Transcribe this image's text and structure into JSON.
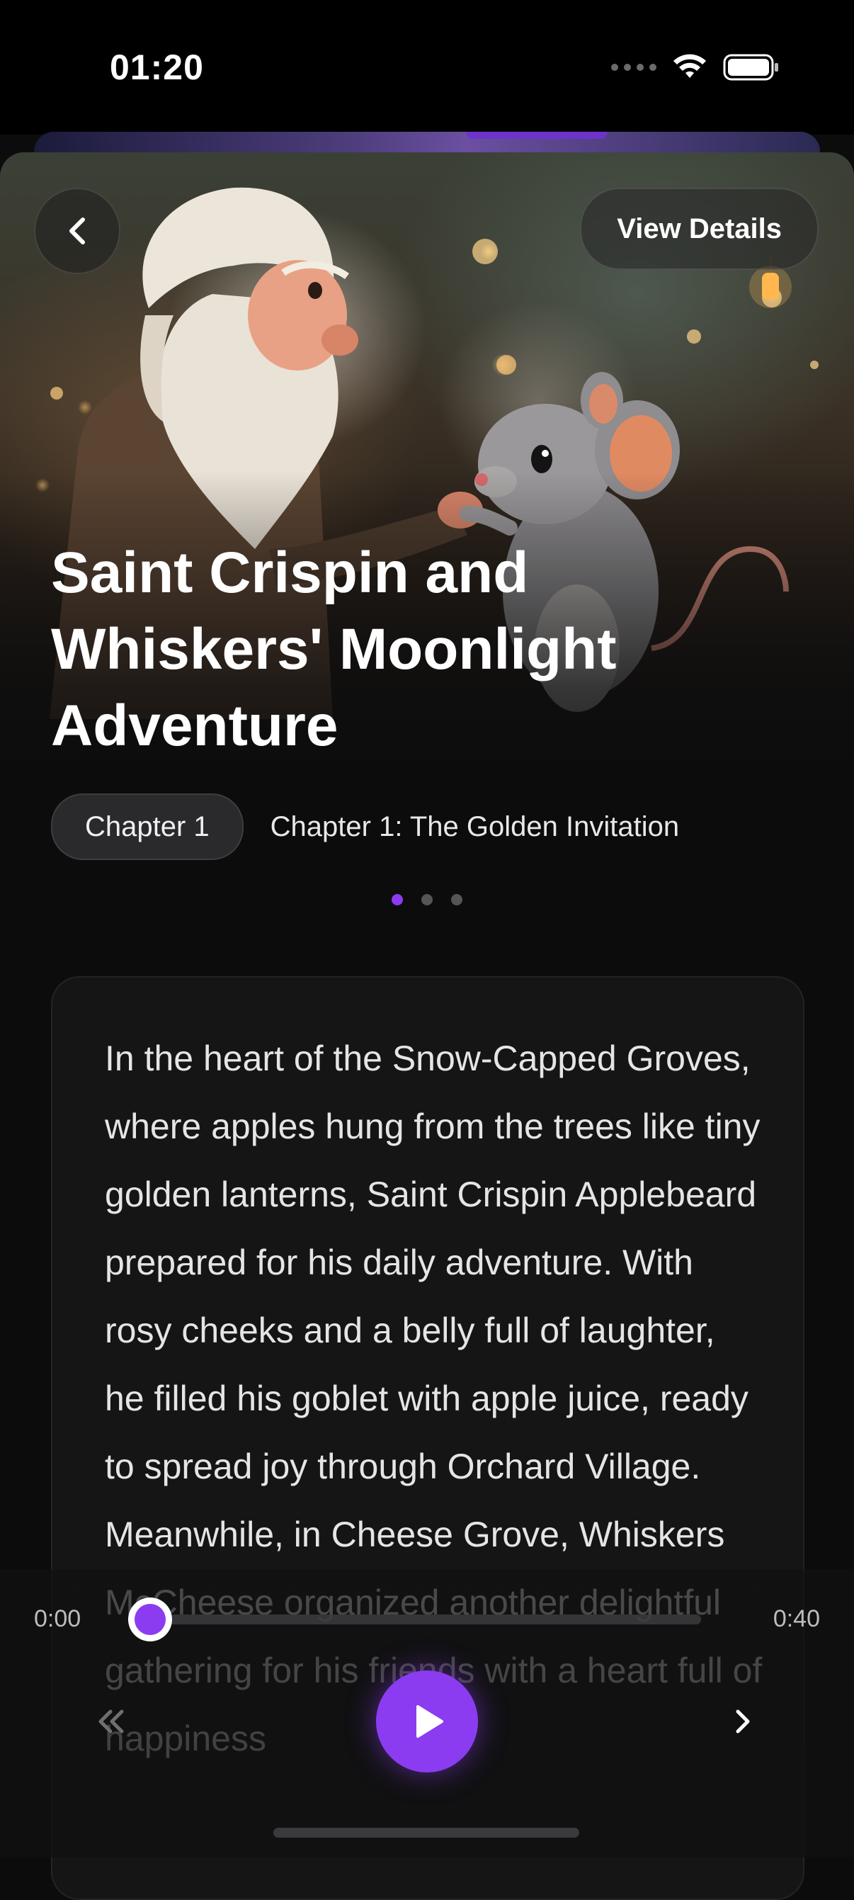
{
  "status_bar": {
    "time": "01:20"
  },
  "header": {
    "view_details_label": "View Details"
  },
  "story": {
    "title": "Saint Crispin and Whiskers' Moonlight Adventure",
    "chapter_badge": "Chapter 1",
    "chapter_title": "Chapter 1: The Golden Invitation",
    "pager": {
      "pages": 3,
      "active_index": 0
    },
    "text": "In the heart of the Snow-Capped Groves, where apples hung from the trees like tiny golden lanterns, Saint Crispin Applebeard prepared for his daily adventure. With rosy cheeks and a belly full of laughter, he filled his goblet with apple juice, ready to spread joy through Orchard Village. Meanwhile, in Cheese Grove, Whiskers McCheese organized another delightful gathering for his friends with a heart full of happiness"
  },
  "player": {
    "elapsed": "0:00",
    "total": "0:40",
    "progress": 0.0,
    "rewind_icon": "double-chevron-left-icon",
    "play_icon": "play-icon",
    "next_icon": "chevron-right-icon"
  },
  "colors": {
    "accent": "#8b3cf0",
    "background": "#0c0c0d",
    "card": "#151516"
  }
}
